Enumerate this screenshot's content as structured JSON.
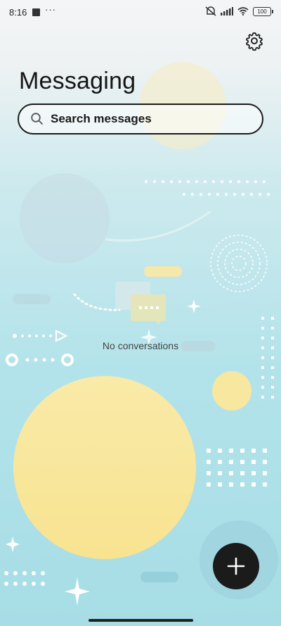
{
  "status_bar": {
    "time": "8:16",
    "dots": "···",
    "battery": "100"
  },
  "header": {
    "title": "Messaging"
  },
  "search": {
    "placeholder": "Search messages"
  },
  "main": {
    "empty_text": "No conversations"
  },
  "colors": {
    "accent_dark": "#1b1b1b",
    "circle_yellow": "#f8e79e",
    "bg_teal": "#a7dde6"
  },
  "icons": {
    "settings": "gear-icon",
    "search": "search-icon",
    "fab": "plus-icon"
  }
}
